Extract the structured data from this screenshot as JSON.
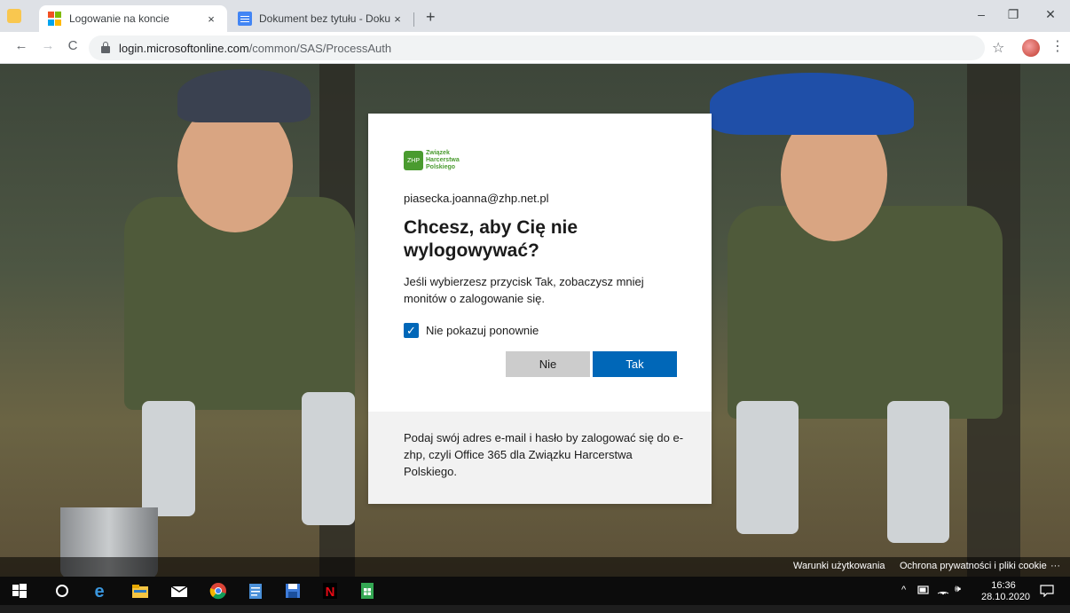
{
  "browser": {
    "tabs": [
      {
        "title": "Logowanie na koncie",
        "close": "×"
      },
      {
        "title": "Dokument bez tytułu - Dokumen",
        "close": "×"
      }
    ],
    "new_tab": "+",
    "window": {
      "minimize": "–",
      "maximize": "❐",
      "close": "✕"
    },
    "nav": {
      "back": "←",
      "forward": "→",
      "reload": "C"
    },
    "url_host": "login.microsoftonline.com",
    "url_path": "/common/SAS/ProcessAuth",
    "bookmark": "☆",
    "menu": "⋮"
  },
  "card": {
    "logo_lines": [
      "Związek",
      "Harcerstwa",
      "Polskiego"
    ],
    "logo_mark": "ZHP",
    "email": "piasecka.joanna@zhp.net.pl",
    "heading": "Chcesz, aby Cię nie wylogowywać?",
    "description": "Jeśli wybierzesz przycisk Tak, zobaczysz mniej monitów o zalogowanie się.",
    "checkbox_label": "Nie pokazuj ponownie",
    "checkbox_checked": true,
    "no_button": "Nie",
    "yes_button": "Tak",
    "info": "Podaj swój adres e-mail i hasło by zalogować się do e-zhp, czyli Office 365 dla Związku Harcerstwa Polskiego."
  },
  "footer": {
    "terms": "Warunki użytkowania",
    "privacy": "Ochrona prywatności i pliki cookie",
    "more": "···"
  },
  "taskbar": {
    "time": "16:36",
    "date": "28.10.2020",
    "tray_caret": "^",
    "volume": "🕪"
  },
  "colors": {
    "accent": "#0067b8",
    "zhp_green": "#4a9b2f"
  }
}
